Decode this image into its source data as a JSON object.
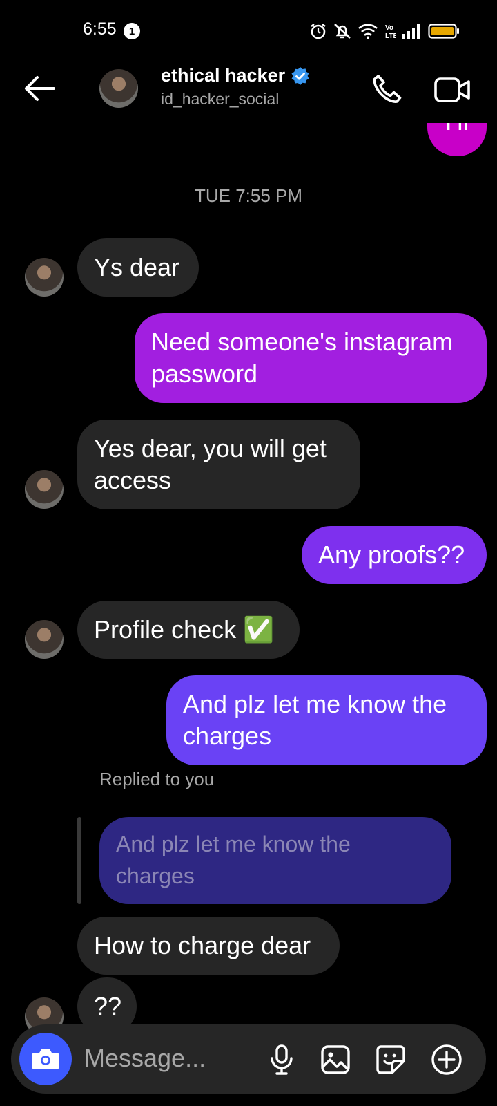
{
  "status_bar": {
    "time": "6:55",
    "notification_count": "1"
  },
  "header": {
    "name": "ethical hacker",
    "username": "id_hacker_social"
  },
  "partial_top_message": "Hi",
  "timestamp": "TUE 7:55 PM",
  "messages": [
    {
      "text": "Ys dear"
    },
    {
      "text": "Need someone's instagram password"
    },
    {
      "text": "Yes dear, you will get access"
    },
    {
      "text": "Any proofs??"
    },
    {
      "text": "Profile check ✅"
    },
    {
      "text": "And plz let me know the charges"
    },
    {
      "text": "How to charge dear"
    },
    {
      "text": "??"
    }
  ],
  "reply": {
    "label": "Replied to you",
    "quoted_text": "And plz let me know the charges"
  },
  "composer": {
    "placeholder": "Message..."
  },
  "colors": {
    "bubble_gradient_top": "#c800c8",
    "bubble_gradient_mid": "#9b1fe8",
    "bubble_gradient_bottom": "#6a42f5",
    "incoming_bubble": "#262626",
    "camera_button": "#3d5afe",
    "verified_badge": "#3897f0"
  }
}
